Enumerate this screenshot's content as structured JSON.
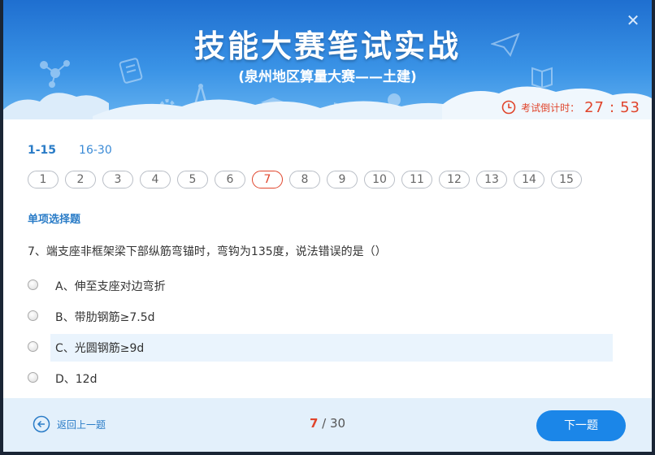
{
  "banner": {
    "title": "技能大赛笔试实战",
    "subtitle": "(泉州地区算量大赛——土建)",
    "close_label": "✕"
  },
  "timer": {
    "label": "考试倒计时：",
    "minutes": "27",
    "separator": ":",
    "seconds": "53"
  },
  "range_tabs": [
    {
      "label": "1-15",
      "active": true
    },
    {
      "label": "16-30",
      "active": false
    }
  ],
  "question_numbers": [
    "1",
    "2",
    "3",
    "4",
    "5",
    "6",
    "7",
    "8",
    "9",
    "10",
    "11",
    "12",
    "13",
    "14",
    "15"
  ],
  "current_question": "7",
  "section_title": "单项选择题",
  "question_text": "7、端支座非框架梁下部纵筋弯锚时，弯钩为135度，说法错误的是（）",
  "options": [
    {
      "text": "A、伸至支座对边弯折",
      "highlighted": false
    },
    {
      "text": "B、带肋钢筋≥7.5d",
      "highlighted": false
    },
    {
      "text": "C、光圆钢筋≥9d",
      "highlighted": true
    },
    {
      "text": "D、12d",
      "highlighted": false
    }
  ],
  "footer": {
    "prev_label": "返回上一题",
    "progress_current": "7",
    "progress_sep": " / ",
    "progress_total": "30",
    "next_label": "下一题"
  },
  "colors": {
    "accent_blue": "#1b86e8",
    "accent_red": "#e0452c",
    "highlight_bg": "#eaf4fd"
  }
}
